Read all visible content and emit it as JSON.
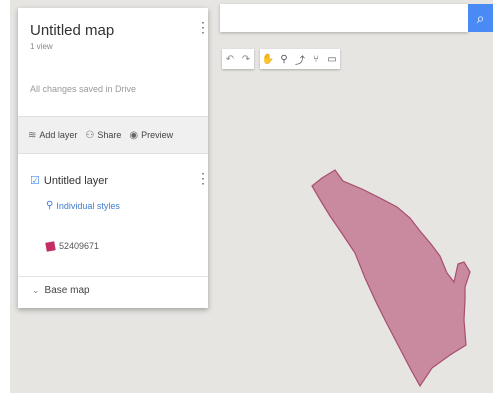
{
  "panel": {
    "title": "Untitled map",
    "views": "1 view",
    "save_status": "All changes saved in Drive",
    "actions": [
      {
        "label": "Add layer",
        "icon": "add-layer-icon"
      },
      {
        "label": "Share",
        "icon": "share-icon"
      },
      {
        "label": "Preview",
        "icon": "preview-icon"
      }
    ],
    "layer": {
      "checked": true,
      "name": "Untitled layer",
      "style_label": "Individual styles",
      "feature_label": "52409671"
    },
    "basemap_label": "Base map"
  },
  "toolbar": {
    "tools": [
      "undo",
      "redo",
      "hand",
      "marker",
      "line",
      "route",
      "ruler"
    ]
  },
  "map": {
    "feature_color": "#c98aa0",
    "feature_stroke": "#a84e6f"
  },
  "colors": {
    "search_button": "#4a8af4",
    "map_background": "#e6e5e2"
  }
}
